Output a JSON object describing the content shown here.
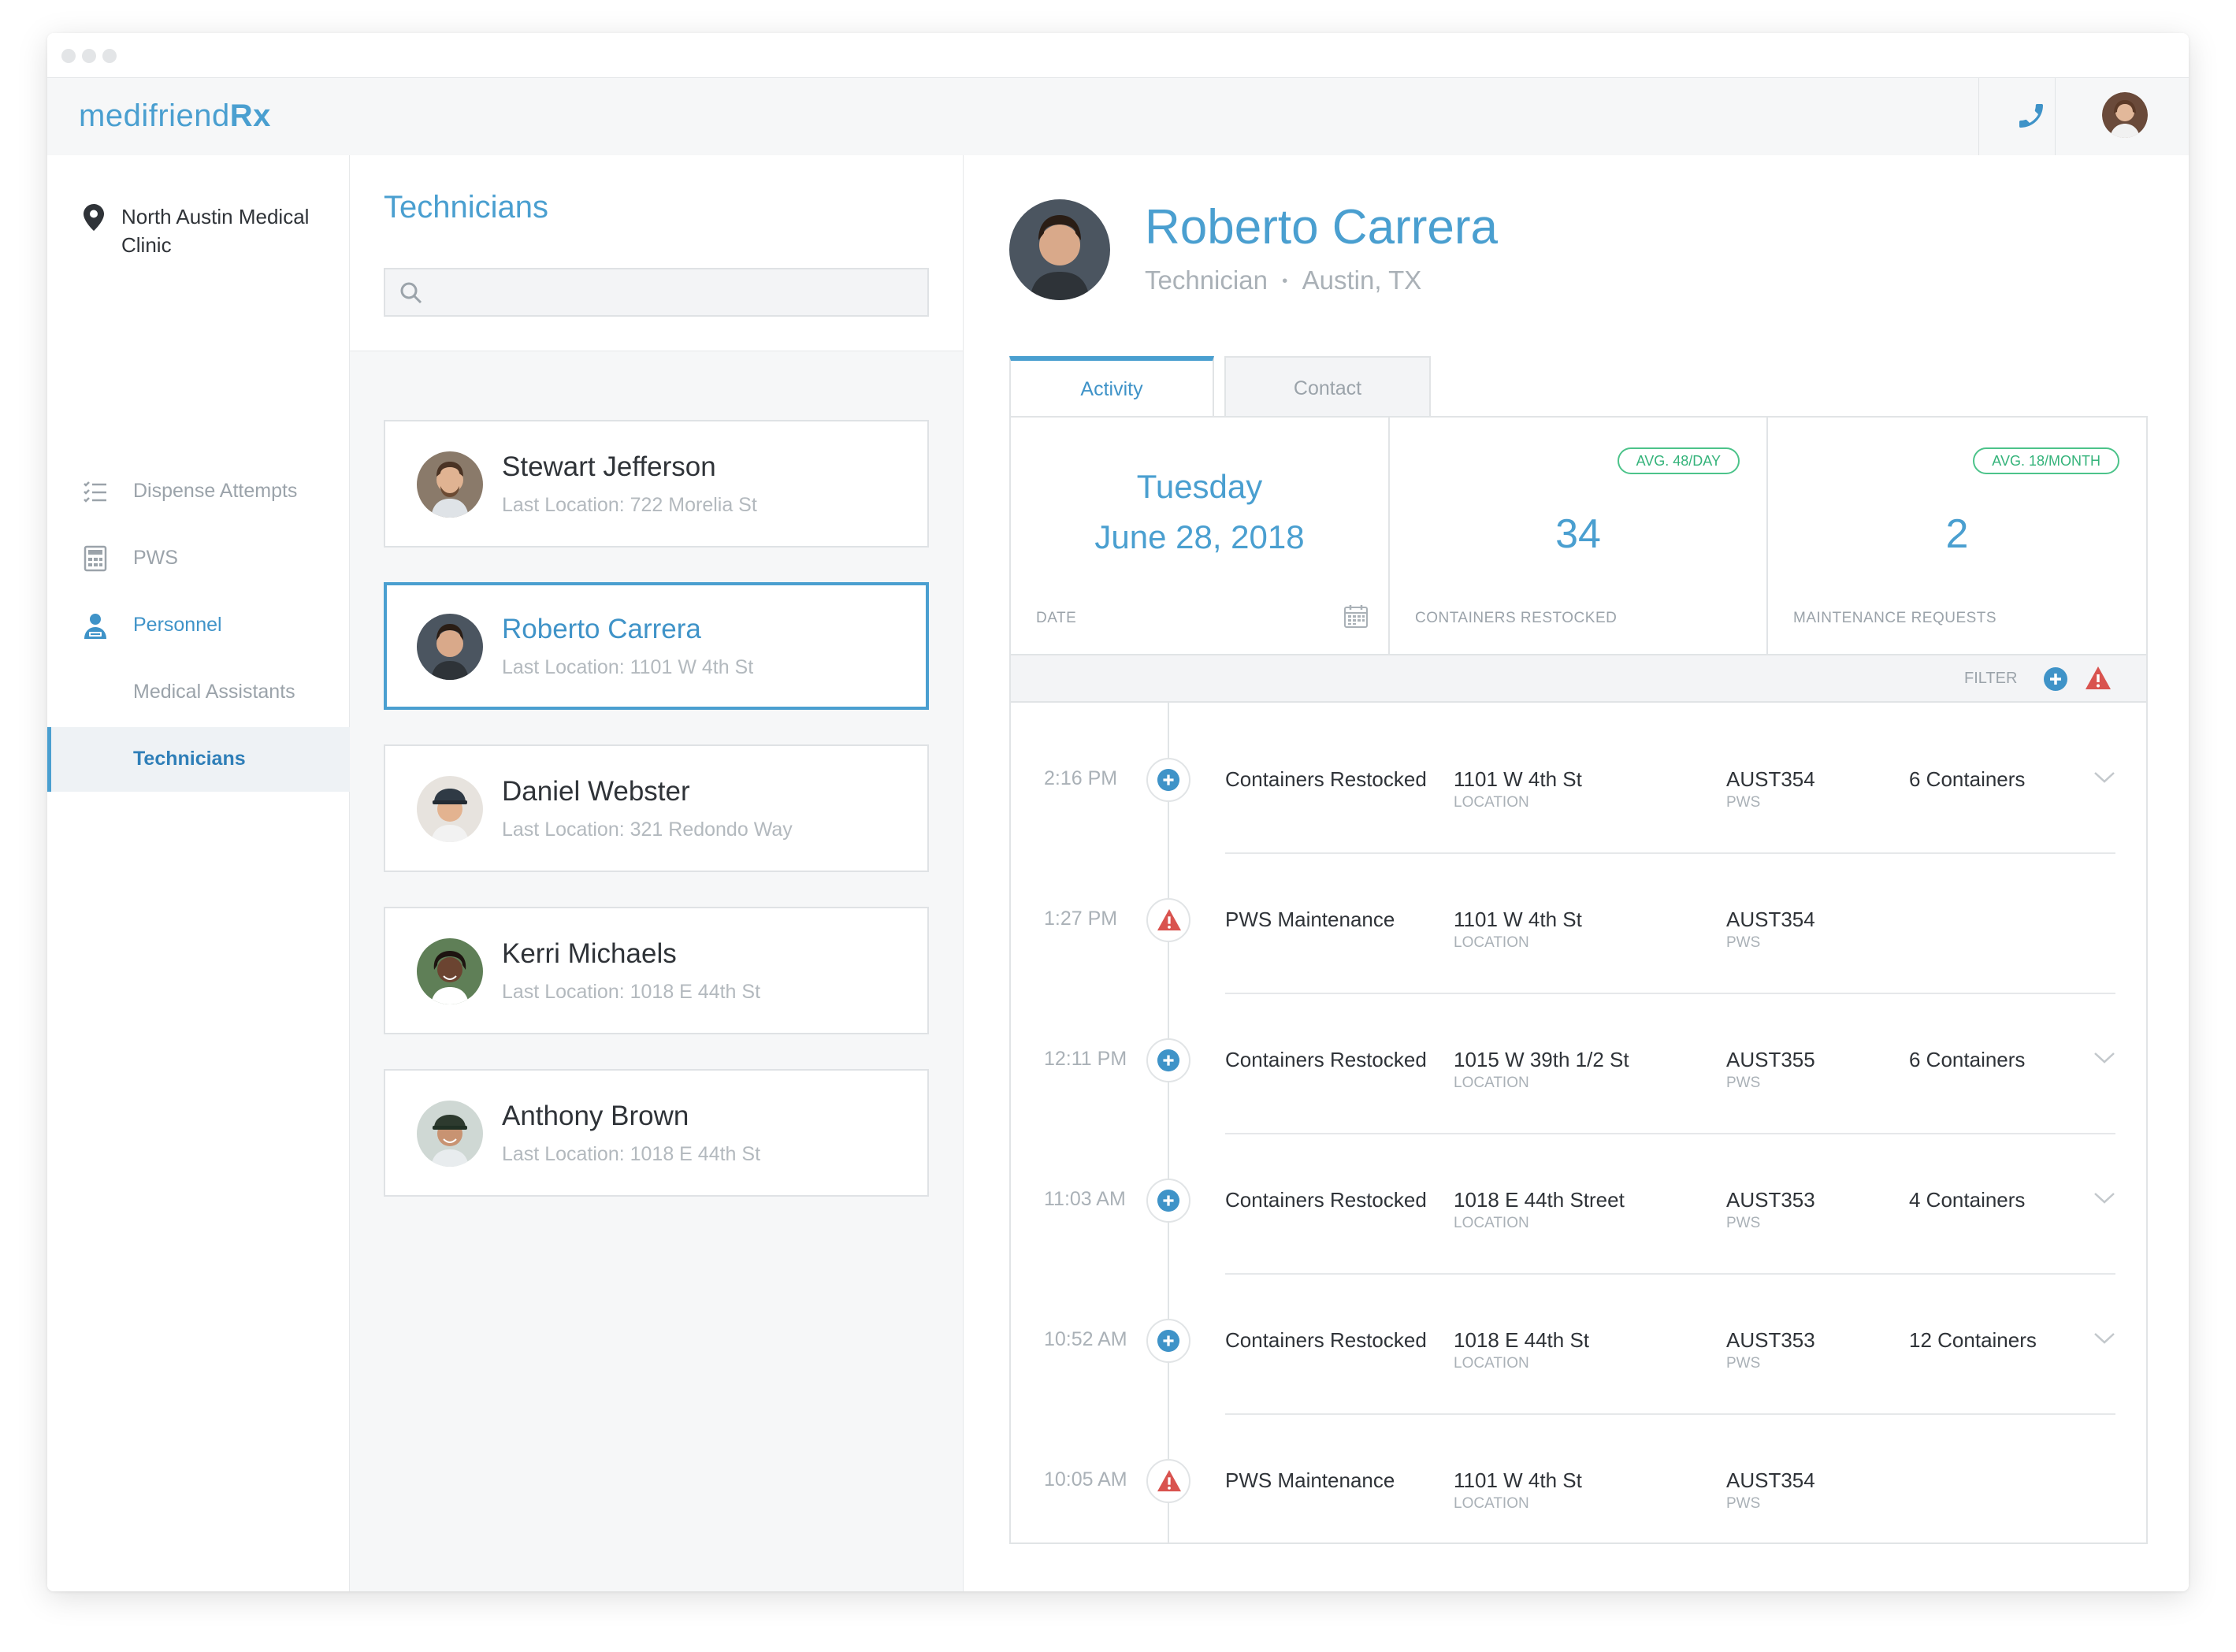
{
  "app": {
    "logo_light": "medifriend",
    "logo_bold": "Rx"
  },
  "sidebar": {
    "clinic": "North Austin Medical Clinic",
    "items": [
      {
        "label": "Dispense Attempts",
        "icon": "checklist-icon"
      },
      {
        "label": "PWS",
        "icon": "calculator-icon"
      },
      {
        "label": "Personnel",
        "icon": "person-icon"
      },
      {
        "label": "Medical Assistants"
      },
      {
        "label": "Technicians"
      }
    ]
  },
  "list": {
    "title": "Technicians",
    "search_placeholder": "",
    "cards": [
      {
        "name": "Stewart Jefferson",
        "location": "Last Location: 722 Morelia St"
      },
      {
        "name": "Roberto Carrera",
        "location": "Last Location: 1101 W 4th St"
      },
      {
        "name": "Daniel Webster",
        "location": "Last Location: 321 Redondo Way"
      },
      {
        "name": "Kerri Michaels",
        "location": "Last Location: 1018 E 44th St"
      },
      {
        "name": "Anthony Brown",
        "location": "Last Location: 1018 E 44th St"
      }
    ]
  },
  "profile": {
    "name": "Roberto Carrera",
    "role": "Technician",
    "city": "Austin, TX",
    "separator": "•"
  },
  "tabs": {
    "activity": "Activity",
    "contact": "Contact"
  },
  "stats": {
    "date_day": "Tuesday",
    "date_full": "June 28, 2018",
    "date_label": "DATE",
    "containers_value": "34",
    "containers_avg": "AVG. 48/DAY",
    "containers_label": "CONTAINERS RESTOCKED",
    "maint_value": "2",
    "maint_avg": "AVG. 18/MONTH",
    "maint_label": "MAINTENANCE REQUESTS"
  },
  "filter": {
    "label": "FILTER"
  },
  "colors": {
    "accent": "#4a9fd0",
    "success": "#4cc38a",
    "alert": "#d9534f"
  },
  "rows": [
    {
      "time": "2:16 PM",
      "type": "restock",
      "activity": "Containers Restocked",
      "location": "1101 W 4th St",
      "location_label": "LOCATION",
      "pws": "AUST354",
      "pws_label": "PWS",
      "count": "6 Containers"
    },
    {
      "time": "1:27 PM",
      "type": "maintenance",
      "activity": "PWS Maintenance",
      "location": "1101 W 4th St",
      "location_label": "LOCATION",
      "pws": "AUST354",
      "pws_label": "PWS",
      "count": ""
    },
    {
      "time": "12:11 PM",
      "type": "restock",
      "activity": "Containers Restocked",
      "location": "1015 W 39th 1/2 St",
      "location_label": "LOCATION",
      "pws": "AUST355",
      "pws_label": "PWS",
      "count": "6 Containers"
    },
    {
      "time": "11:03 AM",
      "type": "restock",
      "activity": "Containers Restocked",
      "location": "1018 E 44th Street",
      "location_label": "LOCATION",
      "pws": "AUST353",
      "pws_label": "PWS",
      "count": "4 Containers"
    },
    {
      "time": "10:52 AM",
      "type": "restock",
      "activity": "Containers Restocked",
      "location": "1018 E 44th St",
      "location_label": "LOCATION",
      "pws": "AUST353",
      "pws_label": "PWS",
      "count": "12 Containers"
    },
    {
      "time": "10:05 AM",
      "type": "maintenance",
      "activity": "PWS Maintenance",
      "location": "1101 W 4th St",
      "location_label": "LOCATION",
      "pws": "AUST354",
      "pws_label": "PWS",
      "count": ""
    }
  ]
}
